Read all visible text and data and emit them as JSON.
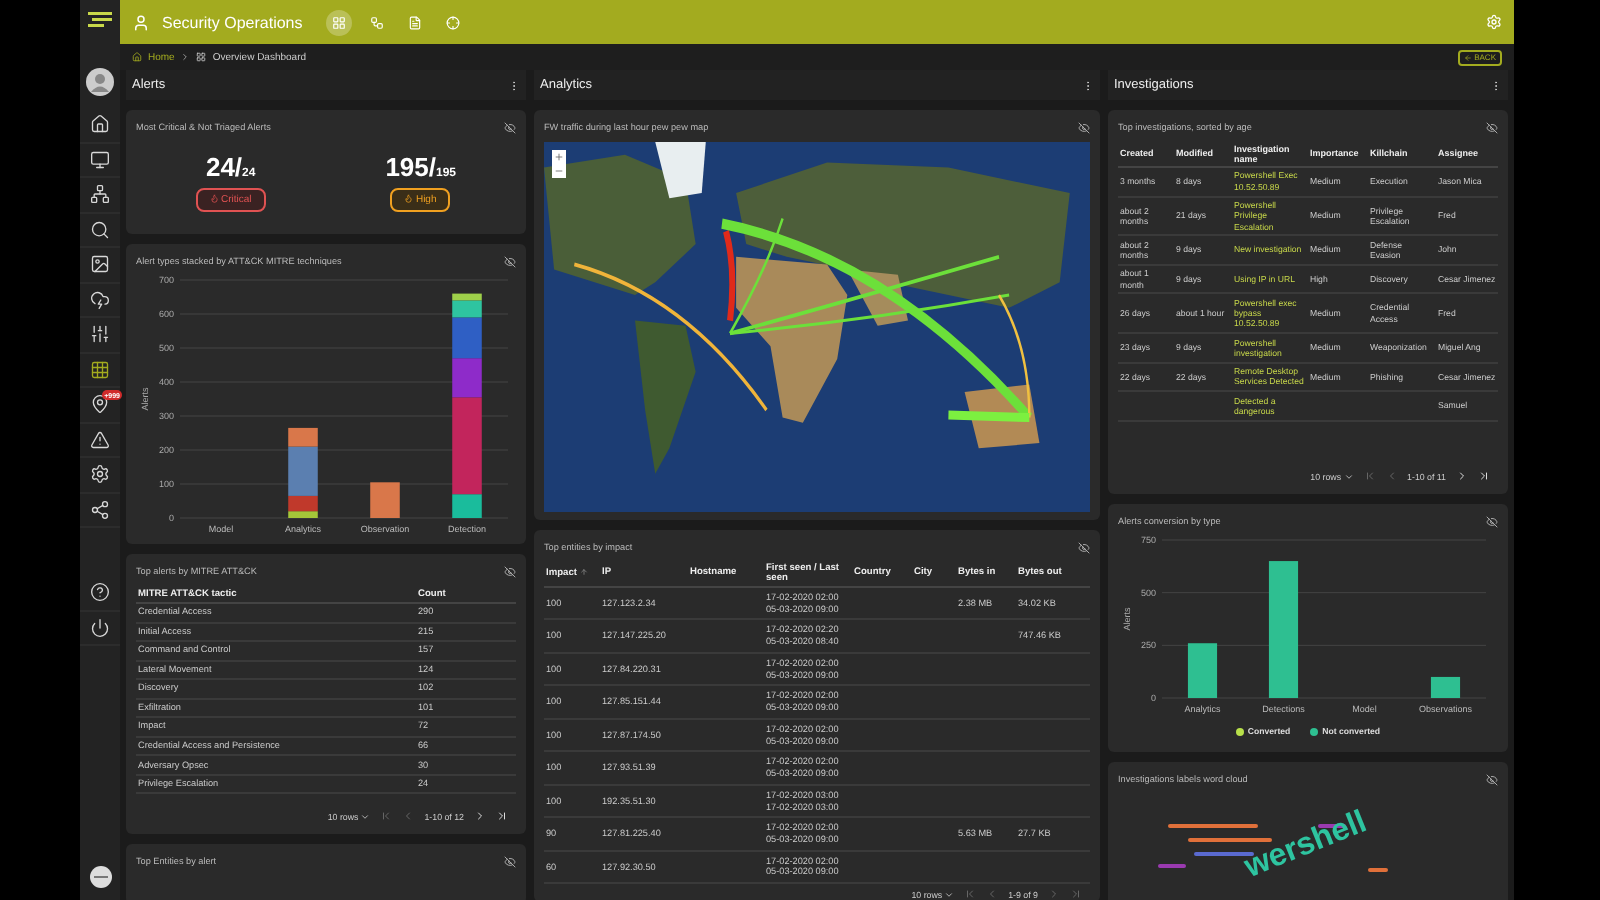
{
  "topbar": {
    "title": "Security Operations",
    "tabs": [
      {
        "kind": "grid",
        "selected": true
      },
      {
        "kind": "workflow",
        "selected": false
      },
      {
        "kind": "document",
        "selected": false
      },
      {
        "kind": "target",
        "selected": false
      }
    ]
  },
  "breadcrumb": [
    "Home",
    "Overview Dashboard"
  ],
  "back_button": "BACK",
  "sidebar": {
    "items": [
      {
        "kind": "home",
        "selected": false
      },
      {
        "kind": "monitor",
        "selected": false
      },
      {
        "kind": "network",
        "selected": false
      },
      {
        "kind": "search",
        "selected": false
      },
      {
        "kind": "report",
        "selected": false
      },
      {
        "kind": "cloud",
        "selected": false
      },
      {
        "kind": "sliders",
        "selected": false
      },
      {
        "kind": "grid",
        "selected": true
      },
      {
        "kind": "pin",
        "selected": false,
        "badge": "+999"
      },
      {
        "kind": "warning",
        "selected": false
      },
      {
        "kind": "settings",
        "selected": false
      },
      {
        "kind": "share",
        "selected": false
      }
    ],
    "footer_items": [
      {
        "kind": "help",
        "selected": false
      },
      {
        "kind": "power",
        "selected": false
      }
    ]
  },
  "alerts": {
    "title": "Alerts",
    "critical_card": {
      "title": "Most Critical & Not Triaged Alerts",
      "counters": [
        {
          "kind": "critical",
          "count": "24/",
          "total": "24",
          "label": "Critical"
        },
        {
          "kind": "high",
          "count": "195/",
          "total": "195",
          "label": "High"
        }
      ]
    },
    "types_chart": {
      "title": "Alert types stacked by ATT&CK MITRE techniques",
      "chart_data": {
        "type": "bar",
        "stacked": true,
        "grid": true,
        "ylabel": "Alerts",
        "categories": [
          "Model",
          "Analytics",
          "Observation",
          "Detection"
        ],
        "ylim": [
          0,
          700
        ],
        "yticks": [
          0,
          100,
          200,
          300,
          400,
          500,
          600,
          700
        ],
        "series": [
          {
            "color": "#1abc9c",
            "values": [
              0,
              0,
              0,
              70
            ]
          },
          {
            "color": "#a4c639",
            "values": [
              0,
              20,
              0,
              0
            ]
          },
          {
            "color": "#c2255c",
            "values": [
              0,
              0,
              0,
              285
            ]
          },
          {
            "color": "#c0392b",
            "values": [
              0,
              45,
              0,
              0
            ]
          },
          {
            "color": "#5b7fb0",
            "values": [
              0,
              145,
              0,
              0
            ]
          },
          {
            "color": "#d9774a",
            "values": [
              0,
              55,
              105,
              0
            ]
          },
          {
            "color": "#8e2bc9",
            "values": [
              0,
              0,
              0,
              115
            ]
          },
          {
            "color": "#2f5fc4",
            "values": [
              0,
              0,
              0,
              120
            ]
          },
          {
            "color": "#2ec4a0",
            "values": [
              0,
              0,
              0,
              50
            ]
          },
          {
            "color": "#9ed04a",
            "values": [
              0,
              0,
              0,
              20
            ]
          }
        ]
      }
    },
    "mitre_table": {
      "title": "Top alerts by MITRE ATT&CK",
      "columns": [
        "MITRE ATT&CK tactic",
        "Count"
      ],
      "rows": [
        [
          "Credential Access",
          "290"
        ],
        [
          "Initial Access",
          "215"
        ],
        [
          "Command and Control",
          "157"
        ],
        [
          "Lateral Movement",
          "124"
        ],
        [
          "Discovery",
          "102"
        ],
        [
          "Exfiltration",
          "101"
        ],
        [
          "Impact",
          "72"
        ],
        [
          "Credential Access and Persistence",
          "66"
        ],
        [
          "Adversary Opsec",
          "30"
        ],
        [
          "Privilege Escalation",
          "24"
        ]
      ],
      "pager": {
        "rows": "10 rows",
        "range": "1-10 of 12",
        "controls": [
          {
            "kind": "first",
            "disabled": true
          },
          {
            "kind": "prev",
            "disabled": true
          },
          {
            "kind": "next",
            "disabled": false
          },
          {
            "kind": "last",
            "disabled": false
          }
        ]
      }
    },
    "entities_card": {
      "title": "Top Entities by alert"
    }
  },
  "analytics": {
    "title": "Analytics",
    "map_card": {
      "title": "FW traffic during last hour pew pew map"
    },
    "entities_table": {
      "title": "Top entities by impact",
      "columns": [
        {
          "label": "Impact",
          "sorted": true
        },
        {
          "label": "IP",
          "sorted": false
        },
        {
          "label": "Hostname",
          "sorted": false
        },
        {
          "label": "First seen / Last seen",
          "sorted": false
        },
        {
          "label": "Country",
          "sorted": false
        },
        {
          "label": "City",
          "sorted": false
        },
        {
          "label": "Bytes in",
          "sorted": false
        },
        {
          "label": "Bytes out",
          "sorted": false
        }
      ],
      "rows": [
        {
          "impact": "100",
          "ip": "127.123.2.34",
          "first_seen": "17-02-2020 02:00",
          "last_seen": "05-03-2020 09:00",
          "bytes_in": "2.38 MB",
          "bytes_out": "34.02 KB"
        },
        {
          "impact": "100",
          "ip": "127.147.225.20",
          "first_seen": "17-02-2020 02:20",
          "last_seen": "05-03-2020 08:40",
          "bytes_out": "747.46 KB"
        },
        {
          "impact": "100",
          "ip": "127.84.220.31",
          "first_seen": "17-02-2020 02:00",
          "last_seen": "05-03-2020 09:00"
        },
        {
          "impact": "100",
          "ip": "127.85.151.44",
          "first_seen": "17-02-2020 02:00",
          "last_seen": "05-03-2020 09:00"
        },
        {
          "impact": "100",
          "ip": "127.87.174.50",
          "first_seen": "17-02-2020 02:00",
          "last_seen": "05-03-2020 09:00"
        },
        {
          "impact": "100",
          "ip": "127.93.51.39",
          "first_seen": "17-02-2020 02:00",
          "last_seen": "05-03-2020 09:00"
        },
        {
          "impact": "100",
          "ip": "192.35.51.30",
          "first_seen": "17-02-2020 03:00",
          "last_seen": "17-02-2020 03:00"
        },
        {
          "impact": "90",
          "ip": "127.81.225.40",
          "first_seen": "17-02-2020 02:00",
          "last_seen": "05-03-2020 09:00",
          "bytes_in": "5.63 MB",
          "bytes_out": "27.7 KB"
        },
        {
          "impact": "60",
          "ip": "127.92.30.50",
          "first_seen": "17-02-2020 02:00",
          "last_seen": "05-03-2020 09:00"
        }
      ],
      "pager": {
        "rows": "10 rows",
        "range": "1-9 of 9",
        "controls": [
          {
            "kind": "first",
            "disabled": true
          },
          {
            "kind": "prev",
            "disabled": true
          },
          {
            "kind": "next",
            "disabled": true
          },
          {
            "kind": "last",
            "disabled": true
          }
        ]
      }
    }
  },
  "investigations": {
    "title": "Investigations",
    "table": {
      "title": "Top investigations, sorted by age",
      "columns": [
        "Created",
        "Modified",
        "Investigation name",
        "Importance",
        "Killchain",
        "Assignee"
      ],
      "rows": [
        {
          "created": "3 months",
          "modified": "8 days",
          "name": "Powershell Exec 10.52.50.89",
          "importance": "Medium",
          "killchain": "Execution",
          "assignee": "Jason Mica"
        },
        {
          "created": "about 2 months",
          "modified": "21 days",
          "name": "Powershell Privilege Escalation",
          "importance": "Medium",
          "killchain": "Privilege Escalation",
          "assignee": "Fred"
        },
        {
          "created": "about 2 months",
          "modified": "9 days",
          "name": "New investigation",
          "importance": "Medium",
          "killchain": "Defense Evasion",
          "assignee": "John"
        },
        {
          "created": "about 1 month",
          "modified": "9 days",
          "name": "Using IP in URL",
          "importance": "High",
          "killchain": "Discovery",
          "assignee": "Cesar Jimenez"
        },
        {
          "created": "26 days",
          "modified": "about 1 hour",
          "name": "Powershell exec bypass 10.52.50.89",
          "importance": "Medium",
          "killchain": "Credential Access",
          "assignee": "Fred"
        },
        {
          "created": "23 days",
          "modified": "9 days",
          "name": "Powershell investigation",
          "importance": "Medium",
          "killchain": "Weaponization",
          "assignee": "Miguel Ang"
        },
        {
          "created": "22 days",
          "modified": "22 days",
          "name": "Remote Desktop Services Detected",
          "importance": "Medium",
          "killchain": "Phishing",
          "assignee": "Cesar Jimenez"
        },
        {
          "name": "Detected a dangerous",
          "assignee": "Samuel"
        }
      ],
      "pager": {
        "rows": "10 rows",
        "range": "1-10 of 11",
        "controls": [
          {
            "kind": "first",
            "disabled": true
          },
          {
            "kind": "prev",
            "disabled": true
          },
          {
            "kind": "next",
            "disabled": false
          },
          {
            "kind": "last",
            "disabled": false
          }
        ]
      }
    },
    "conversion_chart": {
      "title": "Alerts conversion by type",
      "chart_data": {
        "type": "bar",
        "stacked": true,
        "grid": true,
        "ylabel": "Alerts",
        "categories": [
          "Analytics",
          "Detections",
          "Model",
          "Observations"
        ],
        "ylim": [
          0,
          750
        ],
        "yticks": [
          0,
          250,
          500,
          750
        ],
        "series": [
          {
            "name": "Converted",
            "color": "#b8e04a",
            "values": [
              0,
              0,
              0,
              0
            ]
          },
          {
            "name": "Not converted",
            "color": "#2ebf91",
            "values": [
              260,
              650,
              0,
              100
            ]
          }
        ]
      }
    },
    "word_cloud": {
      "title": "Investigations labels word cloud",
      "words": [
        "wershell"
      ]
    }
  }
}
